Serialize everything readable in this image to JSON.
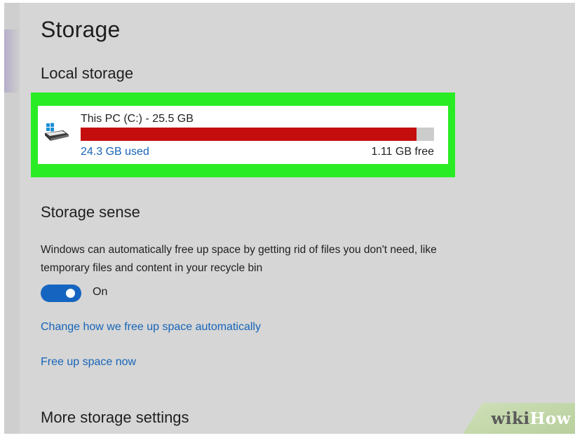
{
  "page": {
    "title": "Storage"
  },
  "local_storage": {
    "title": "Local storage",
    "drive": {
      "name": "This PC (C:) - 25.5 GB",
      "used_label": "24.3 GB used",
      "free_label": "1.11 GB free",
      "used_fraction": 0.95,
      "icon": "windows-drive-icon",
      "bar_color": "#c40e0e"
    }
  },
  "storage_sense": {
    "title": "Storage sense",
    "description": "Windows can automatically free up space by getting rid of files you don't need, like temporary files and content in your recycle bin",
    "toggle": {
      "state": "on",
      "label": "On"
    },
    "links": {
      "change": "Change how we free up space automatically",
      "free_now": "Free up space now"
    }
  },
  "more_settings": {
    "title": "More storage settings"
  },
  "watermark": {
    "wiki": "wiki",
    "how": "How"
  },
  "colors": {
    "highlight": "#2aec25",
    "accent": "#1565c0",
    "link": "#1664b8"
  }
}
